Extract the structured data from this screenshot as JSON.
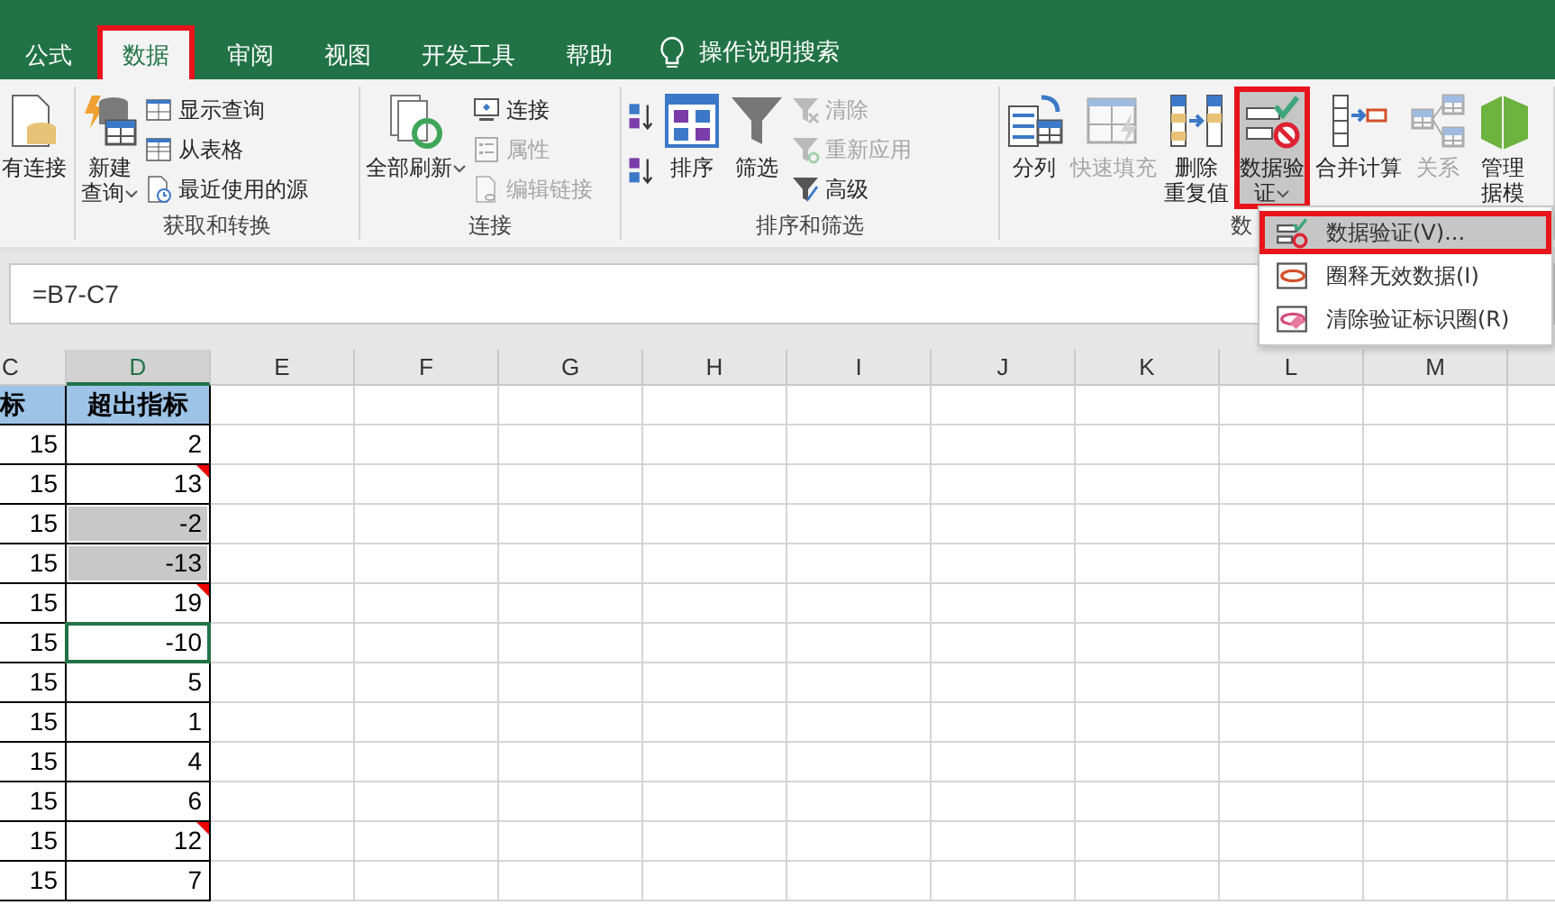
{
  "tabs": [
    {
      "label": "公式",
      "selected": false
    },
    {
      "label": "数据",
      "selected": true
    },
    {
      "label": "审阅",
      "selected": false
    },
    {
      "label": "视图",
      "selected": false
    },
    {
      "label": "开发工具",
      "selected": false
    },
    {
      "label": "帮助",
      "selected": false
    }
  ],
  "search": {
    "label": "操作说明搜索"
  },
  "ribbon": {
    "groups": [
      {
        "buttons": [
          {
            "kind": "large",
            "lines": [
              "有连接"
            ],
            "disabled": false,
            "pressed": false,
            "dropdown": false
          }
        ]
      },
      {
        "label": "获取和转换",
        "buttons": [
          {
            "kind": "large",
            "lines": [
              "新建",
              "查询"
            ],
            "disabled": false,
            "pressed": false,
            "dropdown": true
          },
          {
            "kind": "small",
            "lines": [
              "显示查询"
            ],
            "disabled": false,
            "pressed": false,
            "dropdown": false
          },
          {
            "kind": "small",
            "lines": [
              "从表格"
            ],
            "disabled": false,
            "pressed": false,
            "dropdown": false
          },
          {
            "kind": "small",
            "lines": [
              "最近使用的源"
            ],
            "disabled": false,
            "pressed": false,
            "dropdown": false
          }
        ]
      },
      {
        "label": "连接",
        "buttons": [
          {
            "kind": "large",
            "lines": [
              "全部刷新"
            ],
            "disabled": false,
            "pressed": false,
            "dropdown": true
          },
          {
            "kind": "small",
            "lines": [
              "连接"
            ],
            "disabled": false,
            "pressed": false,
            "dropdown": false
          },
          {
            "kind": "small",
            "lines": [
              "属性"
            ],
            "disabled": true,
            "pressed": false,
            "dropdown": false
          },
          {
            "kind": "small",
            "lines": [
              "编辑链接"
            ],
            "disabled": true,
            "pressed": false,
            "dropdown": false
          }
        ]
      },
      {
        "label": "排序和筛选",
        "buttons": [
          {
            "kind": "icon",
            "disabled": false,
            "pressed": false,
            "dropdown": false
          },
          {
            "kind": "icon",
            "disabled": false,
            "pressed": false,
            "dropdown": false
          },
          {
            "kind": "large",
            "lines": [
              "排序"
            ],
            "disabled": false,
            "pressed": false,
            "dropdown": false
          },
          {
            "kind": "large",
            "lines": [
              "筛选"
            ],
            "disabled": false,
            "pressed": false,
            "dropdown": false
          },
          {
            "kind": "small",
            "lines": [
              "清除"
            ],
            "disabled": true,
            "pressed": false,
            "dropdown": false
          },
          {
            "kind": "small",
            "lines": [
              "重新应用"
            ],
            "disabled": true,
            "pressed": false,
            "dropdown": false
          },
          {
            "kind": "small",
            "lines": [
              "高级"
            ],
            "disabled": false,
            "pressed": false,
            "dropdown": false
          }
        ]
      },
      {
        "label": "数",
        "buttons": [
          {
            "kind": "large",
            "lines": [
              "分列"
            ],
            "disabled": false,
            "pressed": false,
            "dropdown": false
          },
          {
            "kind": "large",
            "lines": [
              "快速填充"
            ],
            "disabled": true,
            "pressed": false,
            "dropdown": false
          },
          {
            "kind": "large",
            "lines": [
              "删除",
              "重复值"
            ],
            "disabled": false,
            "pressed": false,
            "dropdown": false
          },
          {
            "kind": "large",
            "lines": [
              "数据验",
              "证"
            ],
            "disabled": false,
            "pressed": true,
            "dropdown": true
          },
          {
            "kind": "large",
            "lines": [
              "合并计算"
            ],
            "disabled": false,
            "pressed": false,
            "dropdown": false
          },
          {
            "kind": "large",
            "lines": [
              "关系"
            ],
            "disabled": true,
            "pressed": false,
            "dropdown": false
          },
          {
            "kind": "large",
            "lines": [
              "管理",
              "据模"
            ],
            "disabled": false,
            "pressed": false,
            "dropdown": false
          }
        ]
      }
    ]
  },
  "menu": {
    "items": [
      {
        "label": "数据验证(V)...",
        "selected": true
      },
      {
        "label": "圈释无效数据(I)",
        "selected": false
      },
      {
        "label": "清除验证标识圈(R)",
        "selected": false
      }
    ]
  },
  "formula": "=B7-C7",
  "sheet": {
    "columns": [
      {
        "label": "C",
        "selected": false
      },
      {
        "label": "D",
        "selected": true
      },
      {
        "label": "E",
        "selected": false
      },
      {
        "label": "F",
        "selected": false
      },
      {
        "label": "G",
        "selected": false
      },
      {
        "label": "H",
        "selected": false
      },
      {
        "label": "I",
        "selected": false
      },
      {
        "label": "J",
        "selected": false
      },
      {
        "label": "K",
        "selected": false
      },
      {
        "label": "L",
        "selected": false
      },
      {
        "label": "M",
        "selected": false
      }
    ],
    "rows": [
      {
        "kind": "header",
        "cells": [
          "标",
          "超出指标"
        ],
        "comment": false,
        "shaded": false,
        "selected": false
      },
      {
        "kind": "data",
        "cells": [
          "15",
          "2"
        ],
        "comment": false,
        "shaded": false,
        "selected": false
      },
      {
        "kind": "data",
        "cells": [
          "15",
          "13"
        ],
        "comment": true,
        "shaded": false,
        "selected": false
      },
      {
        "kind": "data",
        "cells": [
          "15",
          "-2"
        ],
        "comment": false,
        "shaded": true,
        "selected": false
      },
      {
        "kind": "data",
        "cells": [
          "15",
          "-13"
        ],
        "comment": false,
        "shaded": true,
        "selected": false
      },
      {
        "kind": "data",
        "cells": [
          "15",
          "19"
        ],
        "comment": true,
        "shaded": false,
        "selected": false
      },
      {
        "kind": "data",
        "cells": [
          "15",
          "-10"
        ],
        "comment": false,
        "shaded": false,
        "selected": true
      },
      {
        "kind": "data",
        "cells": [
          "15",
          "5"
        ],
        "comment": false,
        "shaded": false,
        "selected": false
      },
      {
        "kind": "data",
        "cells": [
          "15",
          "1"
        ],
        "comment": false,
        "shaded": false,
        "selected": false
      },
      {
        "kind": "data",
        "cells": [
          "15",
          "4"
        ],
        "comment": false,
        "shaded": false,
        "selected": false
      },
      {
        "kind": "data",
        "cells": [
          "15",
          "6"
        ],
        "comment": false,
        "shaded": false,
        "selected": false
      },
      {
        "kind": "data",
        "cells": [
          "15",
          "12"
        ],
        "comment": true,
        "shaded": false,
        "selected": false
      },
      {
        "kind": "data",
        "cells": [
          "15",
          "7"
        ],
        "comment": false,
        "shaded": false,
        "selected": false
      }
    ]
  }
}
